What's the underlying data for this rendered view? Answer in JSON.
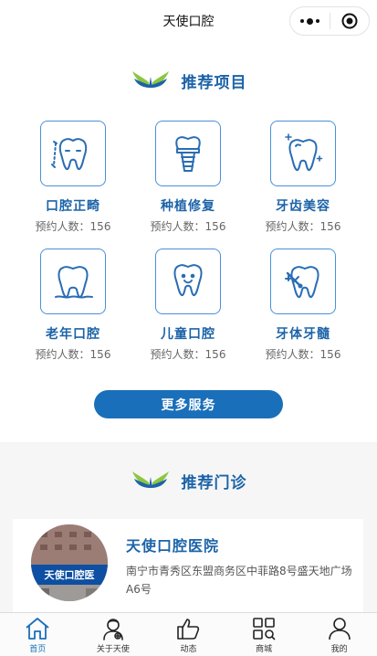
{
  "nav": {
    "title": "天使口腔"
  },
  "recommend": {
    "title": "推荐项目",
    "items": [
      {
        "label": "口腔正畸",
        "count": "预约人数：156",
        "icon": "tooth-orthodontic-icon"
      },
      {
        "label": "种植修复",
        "count": "预约人数：156",
        "icon": "dental-implant-icon"
      },
      {
        "label": "牙齿美容",
        "count": "预约人数：156",
        "icon": "tooth-sparkle-icon"
      },
      {
        "label": "老年口腔",
        "count": "预约人数：156",
        "icon": "tooth-elderly-icon"
      },
      {
        "label": "儿童口腔",
        "count": "预约人数：156",
        "icon": "tooth-smile-icon"
      },
      {
        "label": "牙体牙髓",
        "count": "预约人数：156",
        "icon": "tooth-repair-icon"
      }
    ],
    "more_button": "更多服务"
  },
  "clinic": {
    "title": "推荐门诊",
    "name": "天使口腔医院",
    "address": "南宁市青秀区东盟商务区中菲路8号盛天地广场A6号",
    "photo_sign": "天使口腔医"
  },
  "tabs": [
    {
      "label": "首页",
      "icon": "home-icon"
    },
    {
      "label": "关于天使",
      "icon": "doctor-icon"
    },
    {
      "label": "动态",
      "icon": "thumbs-up-icon"
    },
    {
      "label": "商城",
      "icon": "mall-grid-icon"
    },
    {
      "label": "我的",
      "icon": "user-icon"
    }
  ],
  "colors": {
    "primary": "#1c63a8",
    "button": "#1a6fba",
    "icon_line": "#4a90d9"
  }
}
